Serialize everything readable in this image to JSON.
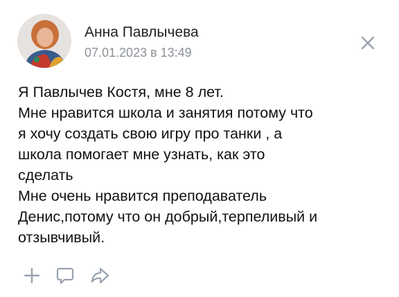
{
  "post": {
    "author": "Анна Павлычева",
    "date": "07.01.2023 в 13:49",
    "text_lines": [
      "Я Павлычев Костя, мне 8 лет.",
      "Мне нравится школа и занятия потому что",
      "я хочу создать свою игру про танки , а",
      "школа помогает мне узнать, как это",
      "сделать",
      "Мне очень нравится преподаватель",
      "Денис,потому что он добрый,терпеливый и",
      "отзывчивый."
    ]
  },
  "icons": {
    "close": "close-icon",
    "add": "plus-icon",
    "comment": "comment-icon",
    "share": "share-icon"
  },
  "colors": {
    "text": "#111111",
    "date": "#8c9197",
    "icon": "#99a2ad"
  }
}
